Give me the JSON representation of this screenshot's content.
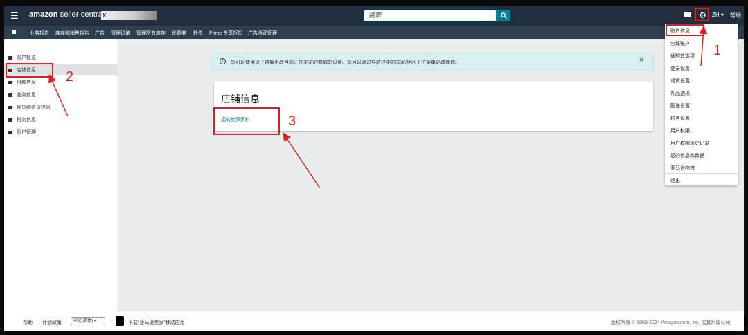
{
  "header": {
    "app_name_bold": "amazon",
    "app_name_rest": " seller central",
    "store_name": "Xi",
    "search_placeholder": "搜索",
    "language": "ZH ▾",
    "help": "帮助"
  },
  "nav": {
    "items": [
      "业务报告",
      "库存和销售报告",
      "广告",
      "管理订单",
      "管理所有库存",
      "优惠券",
      "秒杀",
      "Prime 专享折扣",
      "广告活动管理"
    ]
  },
  "sidebar": {
    "items": [
      {
        "label": "账户概览"
      },
      {
        "label": "店铺信息",
        "active": true
      },
      {
        "label": "付款信息"
      },
      {
        "label": "业务信息"
      },
      {
        "label": "发货和退货信息"
      },
      {
        "label": "税务信息"
      },
      {
        "label": "账户管理"
      }
    ]
  },
  "alert": {
    "message": "您可以使用以下链接更改当前正在浏览的商城的设置。您可以通过导航栏中的国家/地区下拉菜单更改商城。",
    "close": "×"
  },
  "card": {
    "title": "店铺信息",
    "link": "您的卖家资料"
  },
  "settings_menu": {
    "items": [
      "账户信息",
      "全球账户",
      "通知首选项",
      "登录设置",
      "退货设置",
      "礼品选项",
      "配送设置",
      "税务设置",
      "用户权限",
      "用户权限历史记录",
      "您的信息和数据",
      "亚马逊物流"
    ],
    "signout": "退出"
  },
  "footer": {
    "help": "帮助",
    "policy": "计划政策",
    "language_select": "中文(简体) ▾",
    "app_download": "下载“亚马逊卖家”移动应用",
    "copyright": "版权所有 © 1999-2024 Amazon.com, Inc. 或其附属公司"
  },
  "annotations": [
    "1",
    "2",
    "3"
  ],
  "colors": {
    "header_bg": "#232f3e",
    "nav_bg": "#2f3e4e",
    "accent": "#008296",
    "annotation": "#e02020",
    "link": "#007185"
  }
}
